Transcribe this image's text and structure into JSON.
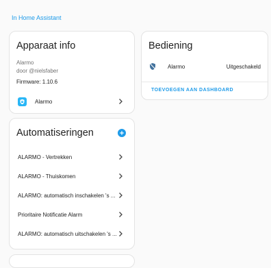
{
  "top_link": "In Home Assistant",
  "device_info": {
    "title": "Apparaat info",
    "name": "Alarmo",
    "author": "door @nielsfaber",
    "firmware": "Firmware: 1.10.6",
    "entity": {
      "label": "Alarmo",
      "icon": "shield-icon"
    }
  },
  "automations": {
    "title": "Automatiseringen",
    "items": [
      "ALARMO - Vertrekken",
      "ALARMO - Thuiskomen",
      "ALARMO: automatisch inschakelen 's ...",
      "Prioritaire Notificatie Alarm",
      "ALARMO: automatisch uitschakelen 's ..."
    ]
  },
  "controls": {
    "title": "Bediening",
    "entity_name": "Alarmo",
    "entity_state": "Uitgeschakeld",
    "add_to_dashboard": "TOEVOEGEN AAN DASHBOARD"
  },
  "colors": {
    "accent": "#1e9be9",
    "icon_bg": "#29b6f6",
    "muted": "#727272"
  }
}
